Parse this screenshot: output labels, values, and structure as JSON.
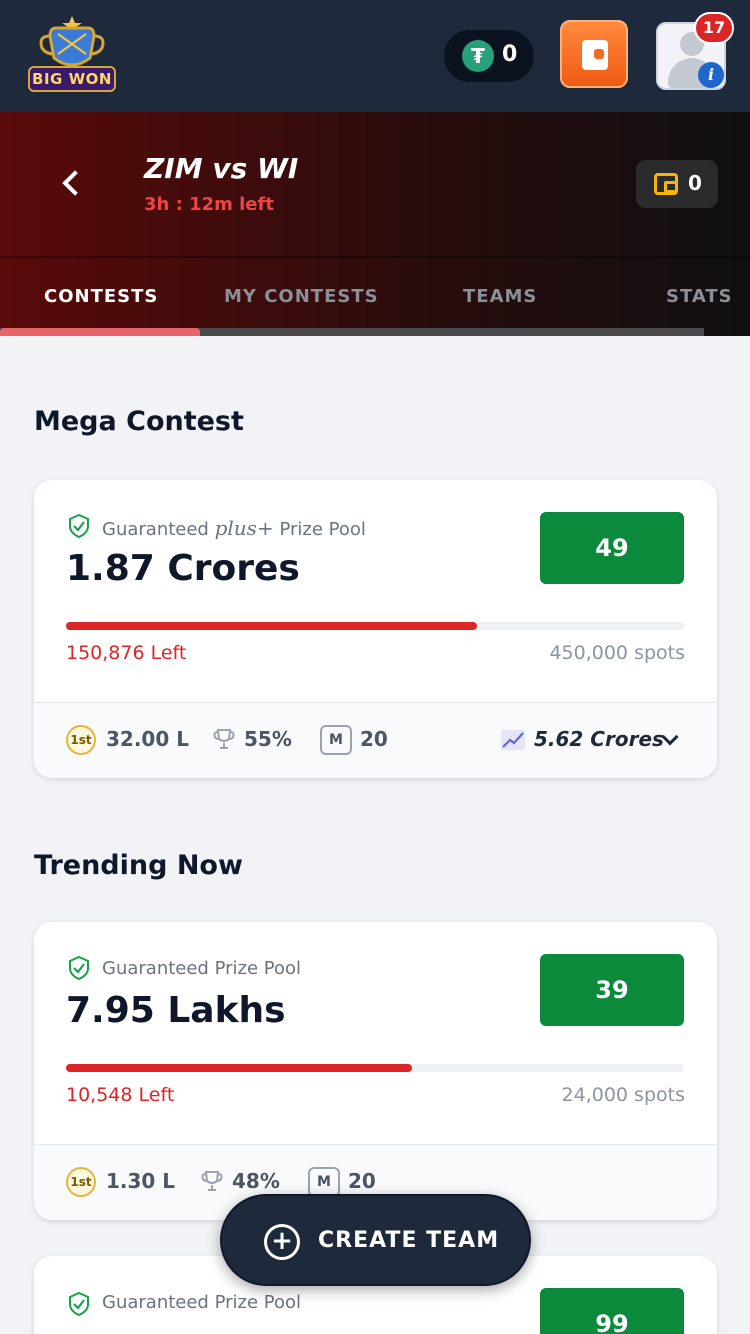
{
  "app": {
    "logo_text": "BIG WON"
  },
  "topbar": {
    "tether_balance": "0",
    "notifications_count": "17"
  },
  "match": {
    "title": "ZIM vs WI",
    "time_left": "3h : 12m left",
    "wallet_balance": "0"
  },
  "tabs": [
    {
      "label": "CONTESTS",
      "active": true
    },
    {
      "label": "MY CONTESTS",
      "active": false
    },
    {
      "label": "TEAMS",
      "active": false
    },
    {
      "label": "STATS",
      "active": false
    }
  ],
  "sections": {
    "mega": "Mega Contest",
    "trending": "Trending Now"
  },
  "contests": [
    {
      "guarantee_label": "Guaranteed",
      "plus_label": "plus+",
      "pool_label": "Prize Pool",
      "prize": "1.87 Crores",
      "entry_fee": "49",
      "spots_left": "150,876 Left",
      "total_spots": "450,000 spots",
      "fill_fraction": 0.665,
      "first_prize_badge": "1st",
      "first_prize": "32.00 L",
      "win_percent": "55%",
      "max_entries_badge": "M",
      "max_entries": "20",
      "max_prize": "5.62 Crores"
    },
    {
      "guarantee_label": "Guaranteed Prize Pool",
      "prize": "7.95 Lakhs",
      "entry_fee": "39",
      "spots_left": "10,548 Left",
      "total_spots": "24,000 spots",
      "fill_fraction": 0.56,
      "first_prize_badge": "1st",
      "first_prize": "1.30 L",
      "win_percent": "48%",
      "max_entries_badge": "M",
      "max_entries": "20"
    },
    {
      "guarantee_label": "Guaranteed Prize Pool",
      "entry_fee": "99"
    }
  ],
  "create_team": {
    "label": "CREATE TEAM"
  },
  "colors": {
    "topbar": "#1e293b",
    "entry_button": "#0b8a3c",
    "progress": "#dc2626",
    "accent_tab": "#e5656a"
  }
}
